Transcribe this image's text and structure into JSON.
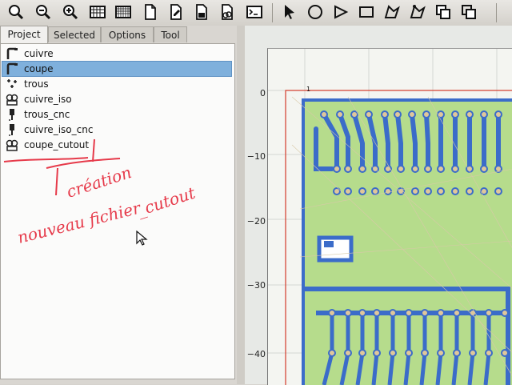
{
  "toolbar": {
    "icons": [
      "zoom-fit-icon",
      "zoom-in-icon",
      "zoom-out-icon",
      "grid-icon",
      "grid-icon-2",
      "new-file-icon",
      "edit-file-icon",
      "document-icon",
      "geometry-icon",
      "terminal-icon",
      "pointer-icon",
      "circle-icon",
      "arc-icon",
      "rectangle-icon",
      "polygon-icon",
      "edit-polygon-icon",
      "copy-icon",
      "move-icon"
    ]
  },
  "tabs": [
    {
      "label": "Project"
    },
    {
      "label": "Selected"
    },
    {
      "label": "Options"
    },
    {
      "label": "Tool"
    }
  ],
  "project_items": [
    {
      "label": "cuivre",
      "icon": "gerber-icon"
    },
    {
      "label": "coupe",
      "icon": "gerber-icon"
    },
    {
      "label": "trous",
      "icon": "excellon-icon"
    },
    {
      "label": "cuivre_iso",
      "icon": "geometry-icon"
    },
    {
      "label": "trous_cnc",
      "icon": "cnc-job-icon"
    },
    {
      "label": "cuivre_iso_cnc",
      "icon": "cnc-job-icon"
    },
    {
      "label": "coupe_cutout",
      "icon": "geometry-icon"
    }
  ],
  "annotation": {
    "line1": "création",
    "line2": "nouveau fichier",
    "line3": "_cutout"
  },
  "plot": {
    "yticks": [
      "0",
      "−10",
      "−20",
      "−30",
      "−40"
    ],
    "top_label": "1",
    "colors": {
      "board": "#b6dc8c",
      "trace": "#3b6cc9",
      "trace_fill": "#7ea6e6",
      "outline": "#d33b2c",
      "handwriting": "#e63a4a"
    }
  }
}
